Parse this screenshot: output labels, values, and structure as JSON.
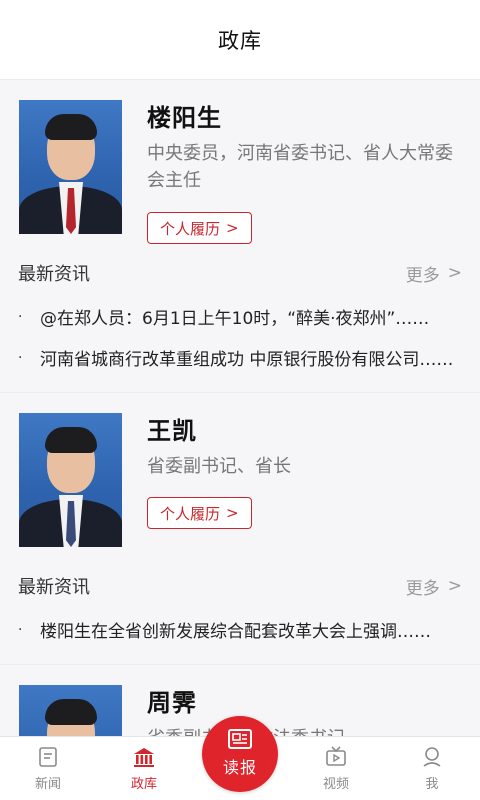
{
  "header": {
    "title": "政库"
  },
  "officials": [
    {
      "name": "楼阳生",
      "position": "中央委员，河南省委书记、省人大常委会主任",
      "resume_label": "个人履历",
      "resume_chevron": ">",
      "news_title": "最新资讯",
      "more_label": "更多",
      "more_chevron": ">",
      "news": [
        "@在郑人员：6月1日上午10时，“醉美·夜郑州”……",
        "河南省城商行改革重组成功 中原银行股份有限公司……"
      ]
    },
    {
      "name": "王凯",
      "position": "省委副书记、省长",
      "resume_label": "个人履历",
      "resume_chevron": ">",
      "news_title": "最新资讯",
      "more_label": "更多",
      "more_chevron": ">",
      "news": [
        "楼阳生在全省创新发展综合配套改革大会上强调……"
      ]
    },
    {
      "name": "周霁",
      "position": "省委副书记、政法委书记"
    }
  ],
  "tabbar": {
    "tabs": [
      {
        "label": "新闻",
        "icon": "news-icon"
      },
      {
        "label": "政库",
        "icon": "government-building-icon",
        "active": true
      },
      {
        "label": "视频",
        "icon": "tv-icon"
      },
      {
        "label": "我",
        "icon": "user-icon"
      }
    ],
    "center": {
      "label": "读报",
      "icon": "newspaper-icon"
    }
  },
  "colors": {
    "accent": "#d1262d",
    "center_button": "#e0242b",
    "background": "#f6f6f8"
  }
}
